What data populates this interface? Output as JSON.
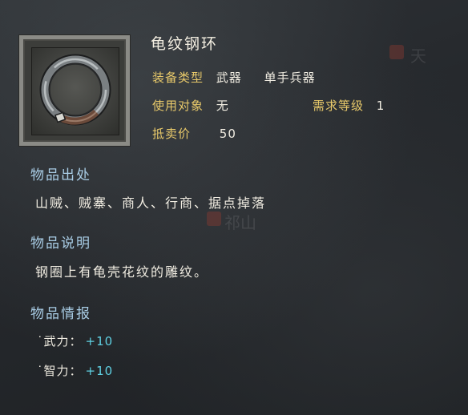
{
  "item": {
    "name": "龟纹钢环",
    "icon": "steel-ring-icon"
  },
  "attributes": {
    "equip_type_label": "装备类型",
    "equip_type_value": "武器",
    "equip_subtype_value": "单手兵器",
    "target_label": "使用对象",
    "target_value": "无",
    "level_label": "需求等级",
    "level_value": "1",
    "price_label": "抵卖价",
    "price_value": "50"
  },
  "source": {
    "heading": "物品出处",
    "text": "山贼、贼寨、商人、行商、据点掉落"
  },
  "description": {
    "heading": "物品说明",
    "text": "钢圈上有龟壳花纹的雕纹。"
  },
  "intel": {
    "heading": "物品情报",
    "stats": [
      {
        "label": "˙武力：",
        "value": "+10"
      },
      {
        "label": "˙智力：",
        "value": "+10"
      }
    ]
  },
  "background": {
    "text_top_right": "天",
    "text_middle": "祁山"
  },
  "colors": {
    "label_gold": "#e8c96a",
    "heading_blue": "#a9cde6",
    "stat_cyan": "#5fd0e2",
    "text_white": "#f1ede2"
  }
}
